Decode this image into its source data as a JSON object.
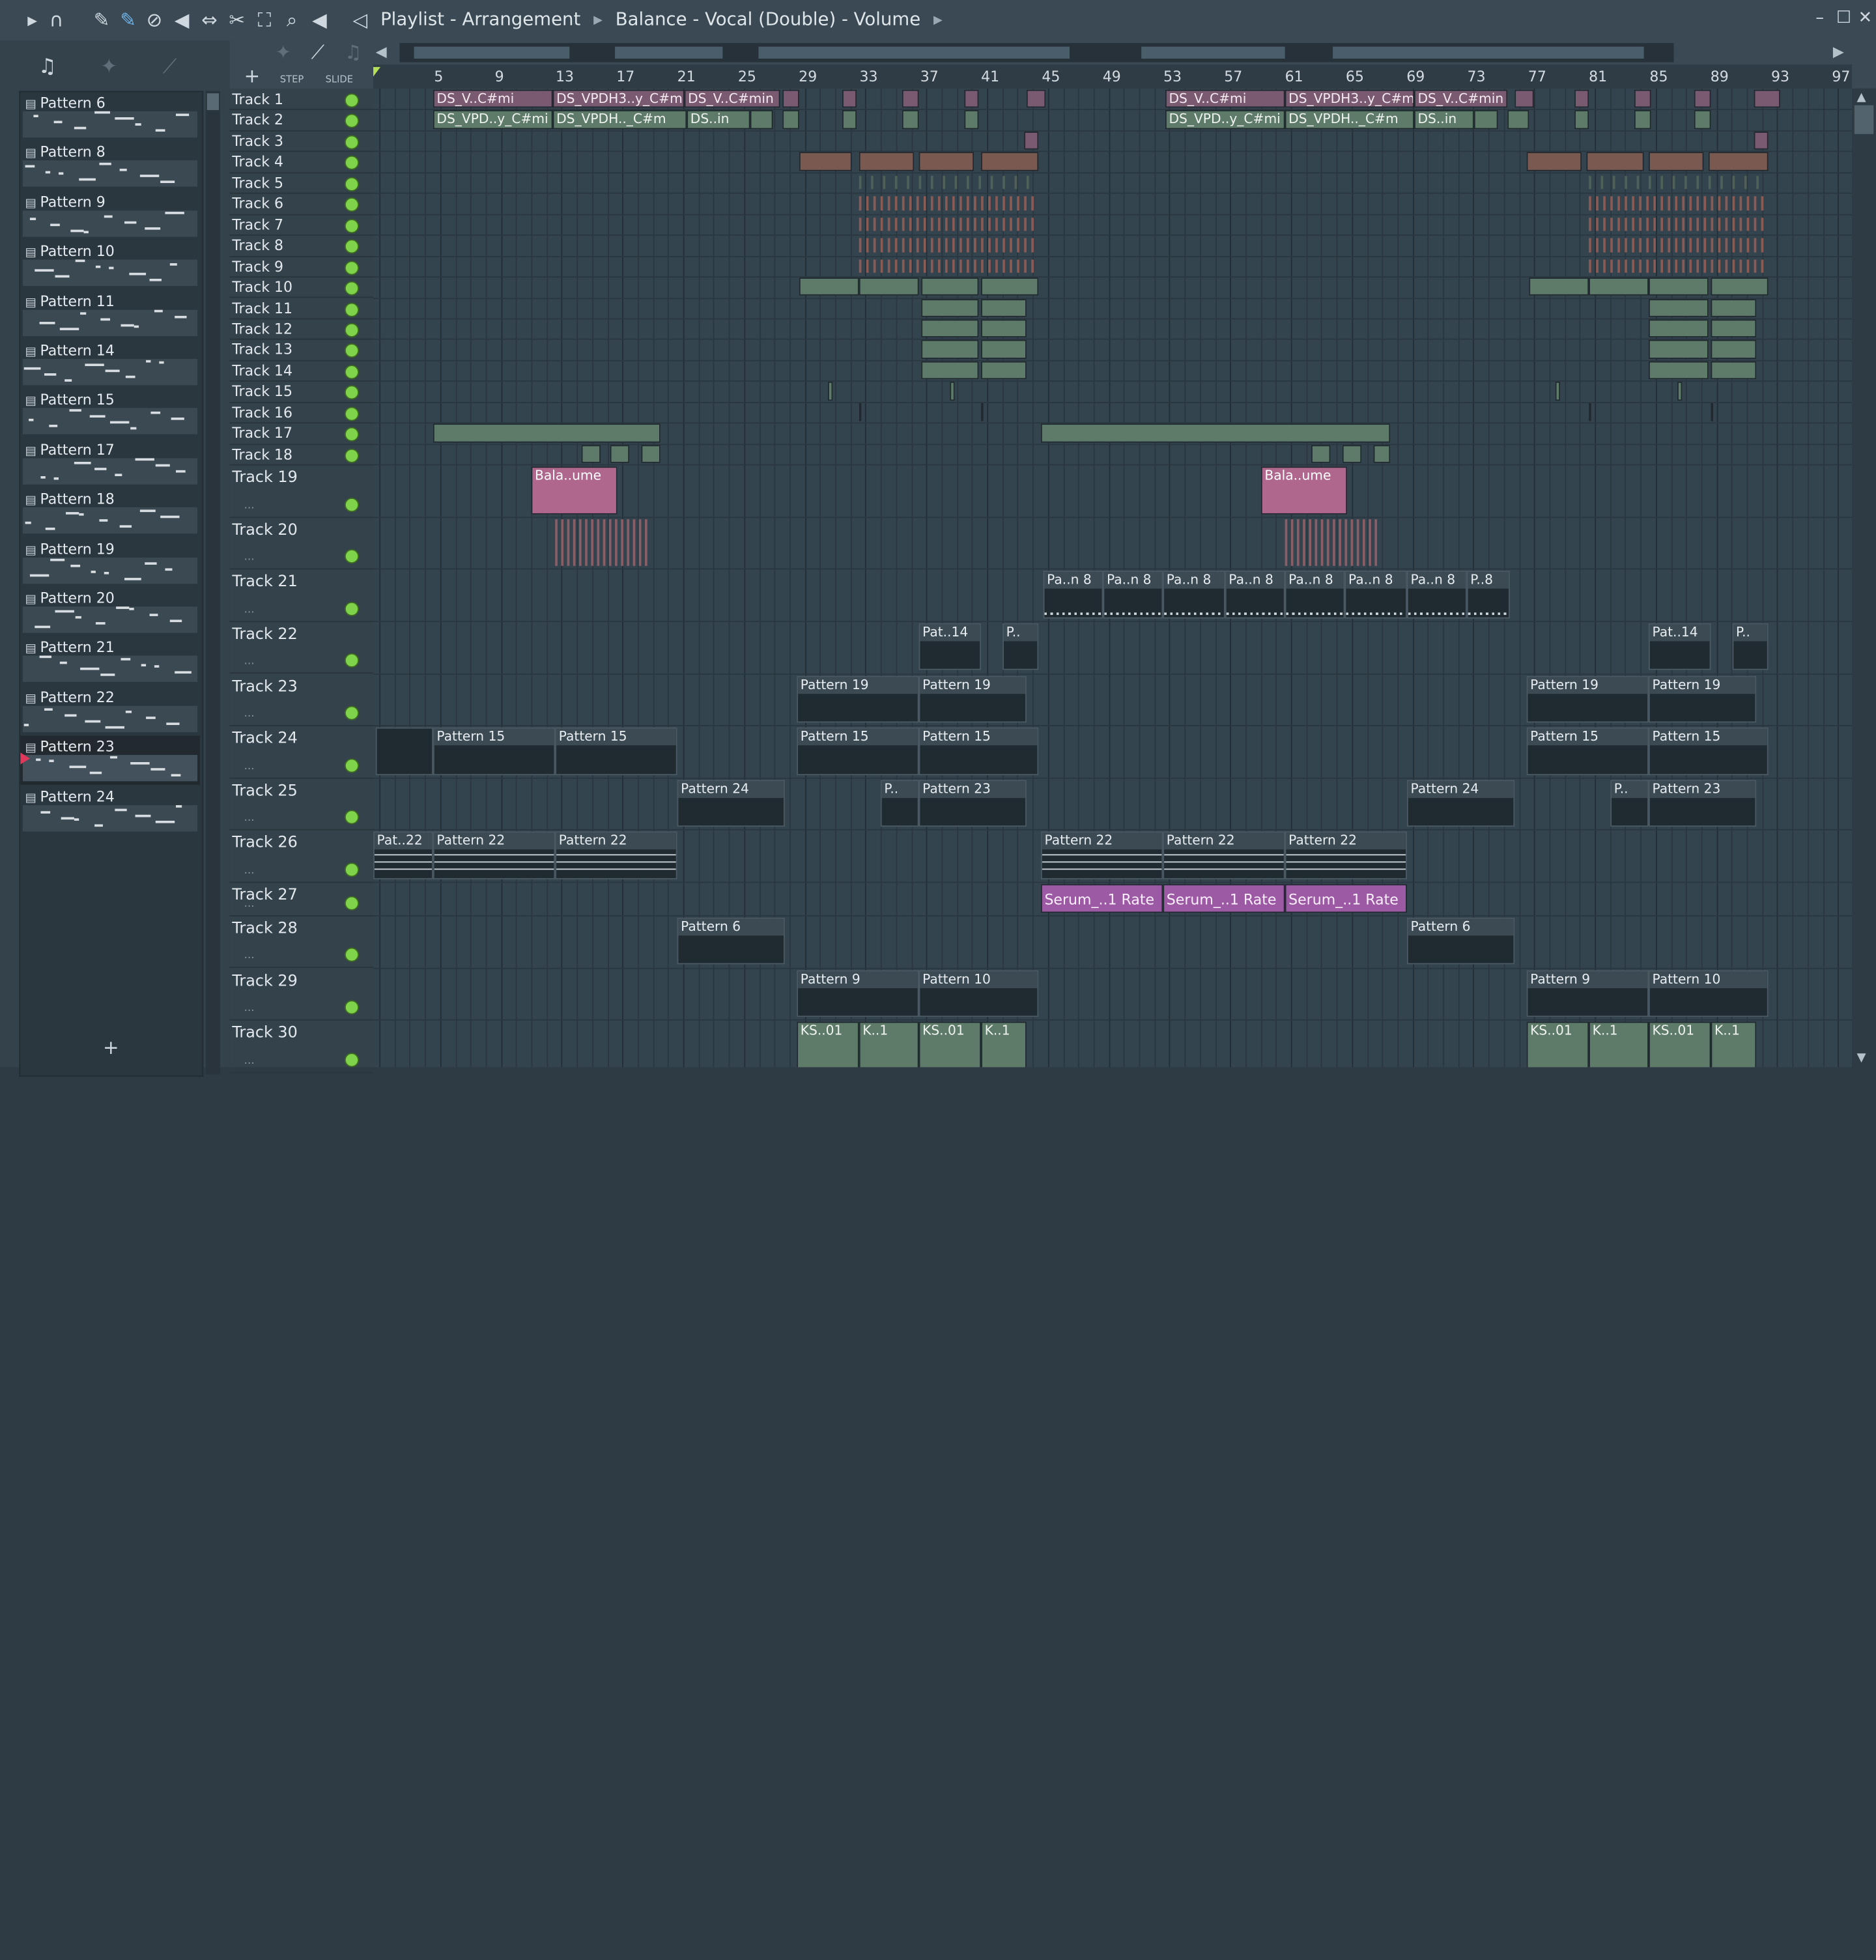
{
  "window": {
    "breadcrumb": [
      "Playlist - Arrangement",
      "Balance - Vocal (Double) - Volume"
    ],
    "controls": {
      "minimize": "–",
      "maximize": "☐",
      "close": "✕"
    }
  },
  "toolbar_icons": [
    "play-arrow-icon",
    "magnet-icon",
    "pencil-icon",
    "paint-icon",
    "delete-icon",
    "mute-icon",
    "slip-icon",
    "slice-icon",
    "select-icon",
    "zoom-icon",
    "playback-icon",
    "speaker-icon"
  ],
  "left_panel": {
    "tool_icons": [
      "piano-icon",
      "step-sequencer-icon",
      "automation-icon"
    ],
    "patterns": [
      {
        "label": "Pattern 6"
      },
      {
        "label": "Pattern 8"
      },
      {
        "label": "Pattern 9"
      },
      {
        "label": "Pattern 10"
      },
      {
        "label": "Pattern 11"
      },
      {
        "label": "Pattern 14"
      },
      {
        "label": "Pattern 15"
      },
      {
        "label": "Pattern 17"
      },
      {
        "label": "Pattern 18"
      },
      {
        "label": "Pattern 19"
      },
      {
        "label": "Pattern 20"
      },
      {
        "label": "Pattern 21"
      },
      {
        "label": "Pattern 22"
      },
      {
        "label": "Pattern 23",
        "selected": true
      },
      {
        "label": "Pattern 24"
      }
    ],
    "add_label": "+"
  },
  "playlist_header": {
    "add_label": "+",
    "step_label": "STEP",
    "slide_label": "SLIDE",
    "ruler": [
      "5",
      "9",
      "13",
      "17",
      "21",
      "25",
      "29",
      "33",
      "37",
      "41",
      "45",
      "49",
      "53",
      "57",
      "61",
      "65",
      "69",
      "73",
      "77",
      "81",
      "85",
      "89",
      "93",
      "97"
    ]
  },
  "tracks": [
    {
      "name": "Track 1"
    },
    {
      "name": "Track 2"
    },
    {
      "name": "Track 3"
    },
    {
      "name": "Track 4"
    },
    {
      "name": "Track 5"
    },
    {
      "name": "Track 6"
    },
    {
      "name": "Track 7"
    },
    {
      "name": "Track 8"
    },
    {
      "name": "Track 9"
    },
    {
      "name": "Track 10"
    },
    {
      "name": "Track 11"
    },
    {
      "name": "Track 12"
    },
    {
      "name": "Track 13"
    },
    {
      "name": "Track 14"
    },
    {
      "name": "Track 15"
    },
    {
      "name": "Track 16"
    },
    {
      "name": "Track 17"
    },
    {
      "name": "Track 18"
    },
    {
      "name": "Track 19"
    },
    {
      "name": "Track 20"
    },
    {
      "name": "Track 21"
    },
    {
      "name": "Track 22"
    },
    {
      "name": "Track 23"
    },
    {
      "name": "Track 24"
    },
    {
      "name": "Track 25"
    },
    {
      "name": "Track 26"
    },
    {
      "name": "Track 27"
    },
    {
      "name": "Track 28"
    },
    {
      "name": "Track 29"
    },
    {
      "name": "Track 30"
    }
  ],
  "clips": {
    "track1": [
      "DS_V..C#mi",
      "DS_VPDH3..y_C#min",
      "DS_V..C#min",
      "DS_V..C#mi",
      "DS_VPDH3..y_C#min",
      "DS_V..C#min"
    ],
    "track2": [
      "DS_VPD..y_C#mi",
      "DS_VPDH.._C#m",
      "DS..in",
      "DS_VPD..y_C#mi",
      "DS_VPDH.._C#m",
      "DS..in"
    ],
    "track19": [
      "Bala..ume",
      "Bala..ume"
    ],
    "track21": [
      "Pa..n 8",
      "Pa..n 8",
      "Pa..n 8",
      "Pa..n 8",
      "Pa..n 8",
      "Pa..n 8",
      "Pa..n 8",
      "P..8"
    ],
    "track22": [
      "Pat..14",
      "P..",
      "Pat..14",
      "P.."
    ],
    "track23": [
      "Pattern 19",
      "Pattern 19",
      "Pattern 19",
      "Pattern 19"
    ],
    "track24": [
      "Pattern 15",
      "Pattern 15",
      "Pattern 15",
      "Pattern 15",
      "Pattern 15",
      "Pattern 15"
    ],
    "track25": [
      "Pattern 24",
      "P..",
      "Pattern 23",
      "Pattern 24",
      "P..",
      "Pattern 23"
    ],
    "track26": [
      "Pat..22",
      "Pattern 22",
      "Pattern 22",
      "Pattern 22",
      "Pattern 22",
      "Pattern 22"
    ],
    "track27": [
      "Serum_..1 Rate",
      "Serum_..1 Rate",
      "Serum_..1 Rate"
    ],
    "track28": [
      "Pattern 6",
      "Pattern 6"
    ],
    "track29": [
      "Pattern 9",
      "Pattern 10",
      "Pattern 9",
      "Pattern 10"
    ],
    "track30": [
      "KS..01",
      "K..1",
      "KS..01",
      "K..1",
      "KS..01",
      "K..1",
      "KS..01",
      "K..1"
    ]
  },
  "colors": {
    "audio_clip": "#5e7a69",
    "automation_clip": "#9b5aa3",
    "pattern_clip_header": "#3c4a53",
    "track_led": "#7fd34a",
    "selected_marker": "#e0385a"
  }
}
